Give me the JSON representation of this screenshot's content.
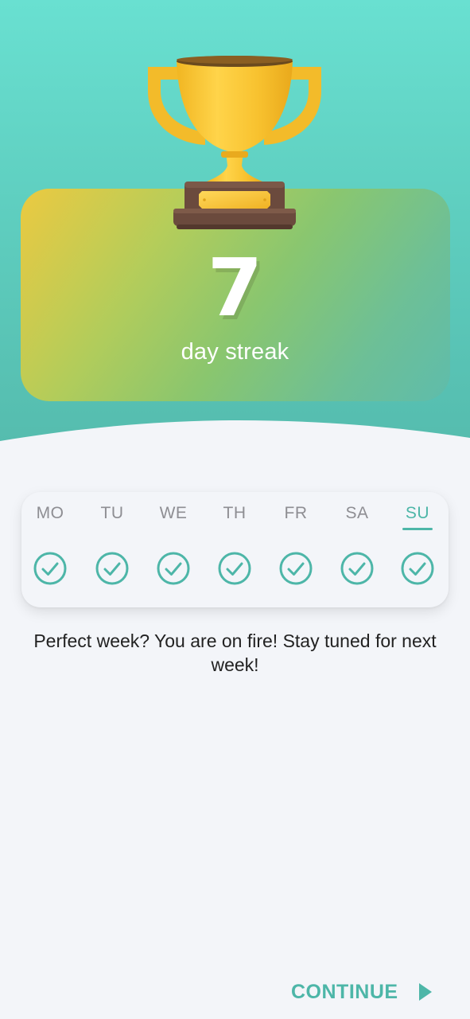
{
  "streak": {
    "count": "7",
    "label": "day streak"
  },
  "week": {
    "days": [
      {
        "label": "MO",
        "completed": true,
        "active": false
      },
      {
        "label": "TU",
        "completed": true,
        "active": false
      },
      {
        "label": "WE",
        "completed": true,
        "active": false
      },
      {
        "label": "TH",
        "completed": true,
        "active": false
      },
      {
        "label": "FR",
        "completed": true,
        "active": false
      },
      {
        "label": "SA",
        "completed": true,
        "active": false
      },
      {
        "label": "SU",
        "completed": true,
        "active": true
      }
    ]
  },
  "message": "Perfect week? You are on fire! Stay tuned for next week!",
  "footer": {
    "continue_label": "CONTINUE",
    "continue_icon": "play-triangle-icon"
  },
  "colors": {
    "accent": "#4db6a8",
    "background": "#f3f5f9",
    "hero_top": "#69e0d1",
    "trophy_gold": "#f7c531",
    "trophy_base": "#6b4a3d"
  }
}
